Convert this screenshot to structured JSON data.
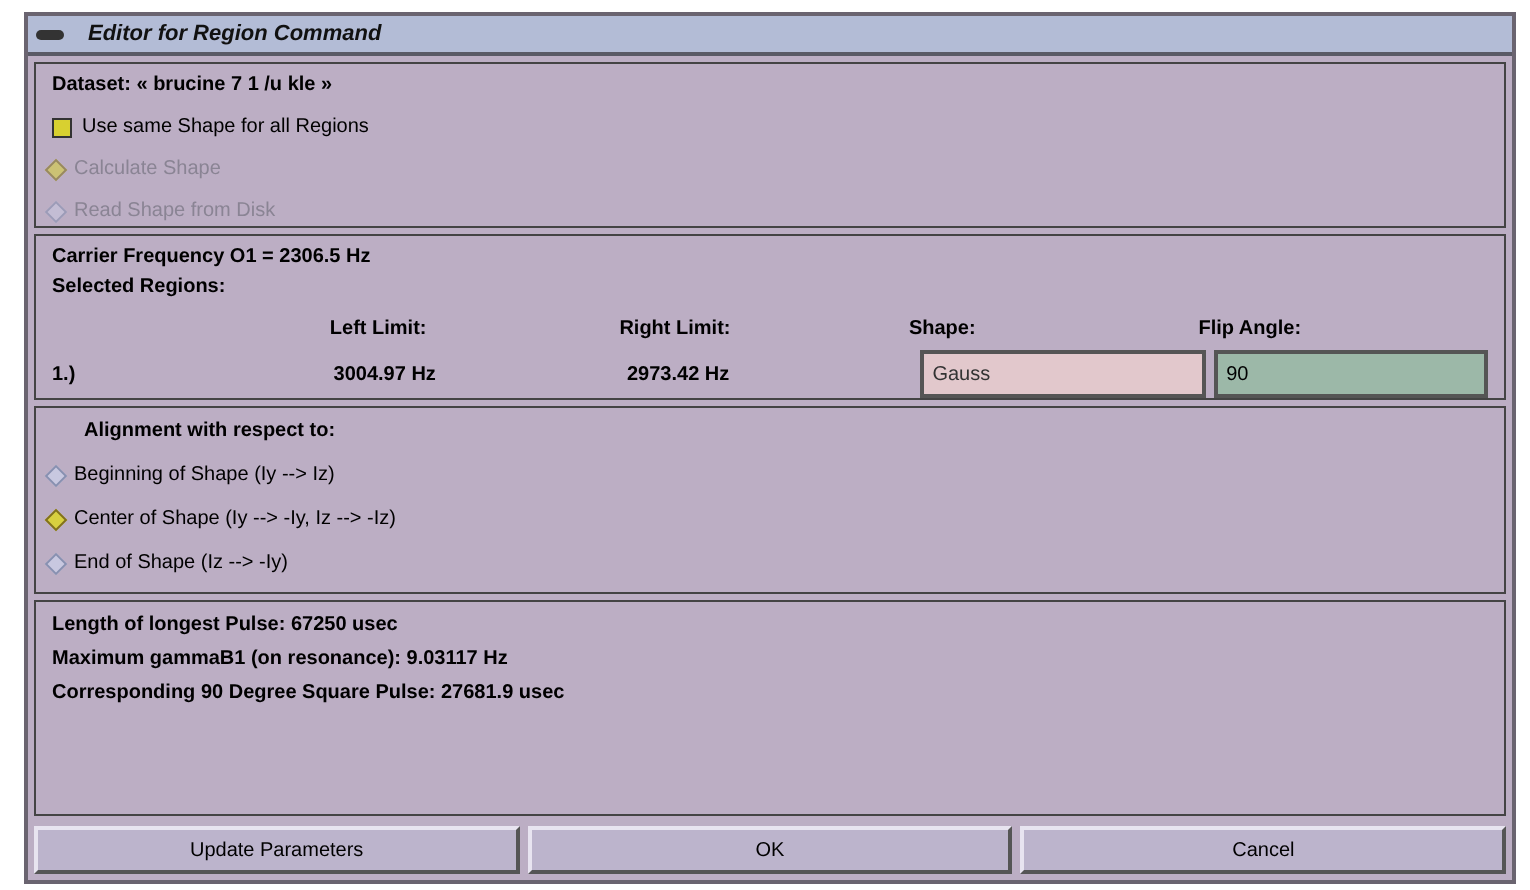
{
  "window": {
    "title": "Editor for Region Command"
  },
  "dataset": "Dataset: « brucine 7 1 /u kle »",
  "same_shape": {
    "label": "Use same Shape for all Regions",
    "checked": true
  },
  "shape_source": [
    {
      "label": "Calculate Shape",
      "selected": true,
      "disabled": true
    },
    {
      "label": "Read Shape from Disk",
      "selected": false,
      "disabled": true
    }
  ],
  "carrier": "Carrier Frequency O1 = 2306.5 Hz",
  "selected_regions_label": "Selected Regions:",
  "regions": {
    "columns": [
      "Left Limit:",
      "Right Limit:",
      "Shape:",
      "Flip Angle:"
    ],
    "rows": [
      {
        "index": "1.)",
        "left": "3004.97 Hz",
        "right": "2973.42 Hz",
        "shape": "Gauss",
        "flip_angle": "90"
      }
    ]
  },
  "alignment": {
    "title": "Alignment with respect to:",
    "options": [
      {
        "label": "Beginning of Shape (Iy --> Iz)",
        "selected": false
      },
      {
        "label": "Center of Shape (Iy --> -Iy, Iz --> -Iz)",
        "selected": true
      },
      {
        "label": "End of Shape (Iz --> -Iy)",
        "selected": false
      }
    ]
  },
  "info": [
    "Length of longest Pulse: 67250 usec",
    "Maximum gammaB1 (on resonance): 9.03117 Hz",
    "Corresponding 90 Degree Square Pulse: 27681.9 usec"
  ],
  "buttons": [
    "Update Parameters",
    "OK",
    "Cancel"
  ]
}
